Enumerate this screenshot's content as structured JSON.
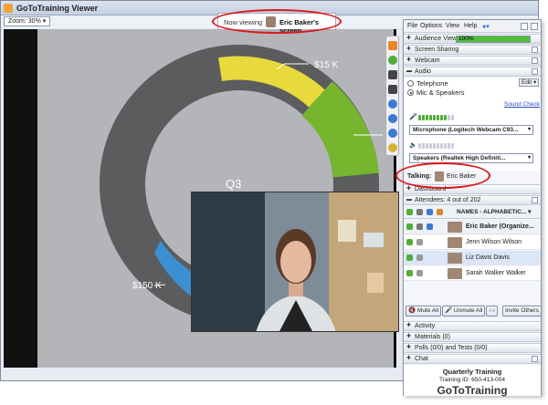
{
  "window": {
    "title": "GoToTraining Viewer",
    "zoom": "Zoom: 30%"
  },
  "now_viewing": {
    "label": "Now viewing",
    "presenter": "Eric Baker's screen"
  },
  "chart_data": {
    "type": "pie",
    "title": "Q3",
    "labels": [
      "$15 K",
      "$150 K"
    ],
    "colors": {
      "ring": "#5b5c5e",
      "yellow": "#e8d93c",
      "green": "#77b52f",
      "blue": "#3c8fd0"
    }
  },
  "panel": {
    "menu": [
      "File",
      "Options",
      "View",
      "Help"
    ],
    "audience_view": {
      "label": "Audience View",
      "value": "100%",
      "fraction": 1.0
    },
    "sections": {
      "screen_sharing": "Screen Sharing",
      "webcam": "Webcam",
      "audio": "Audio",
      "dashboard": "Dashboard",
      "attendees": "Attendees:",
      "attendee_count": "4 out of 202",
      "activity": "Activity",
      "materials": "Materials (0)",
      "polls": "Polls (0/0) and Tests (0/0)",
      "chat": "Chat"
    },
    "audio": {
      "telephone": "Telephone",
      "mic_speakers": "Mic & Speakers",
      "edit": "Edit",
      "sound_check": "Sound Check",
      "microphone": "Microphone (Logitech Webcam C93...",
      "speakers": "Speakers (Realtek High Definiti..."
    },
    "talking": {
      "label": "Talking:",
      "name": "Eric Baker"
    },
    "attendee_header": "NAMES - ALPHABETIC...",
    "attendees": [
      {
        "name": "Eric Baker (Organize..."
      },
      {
        "name": "Jenn Wilson Wilson"
      },
      {
        "name": "Liz Davis Davis"
      },
      {
        "name": "Sarah Walker Walker"
      }
    ],
    "buttons": {
      "mute_all": "Mute All",
      "unmute_all": "Unmute All",
      "all": "All",
      "invite": "Invite Others"
    },
    "footer": {
      "training": "Quarterly Training",
      "training_id": "Training ID: 650-413-004",
      "brand": "GoToTraining"
    }
  }
}
